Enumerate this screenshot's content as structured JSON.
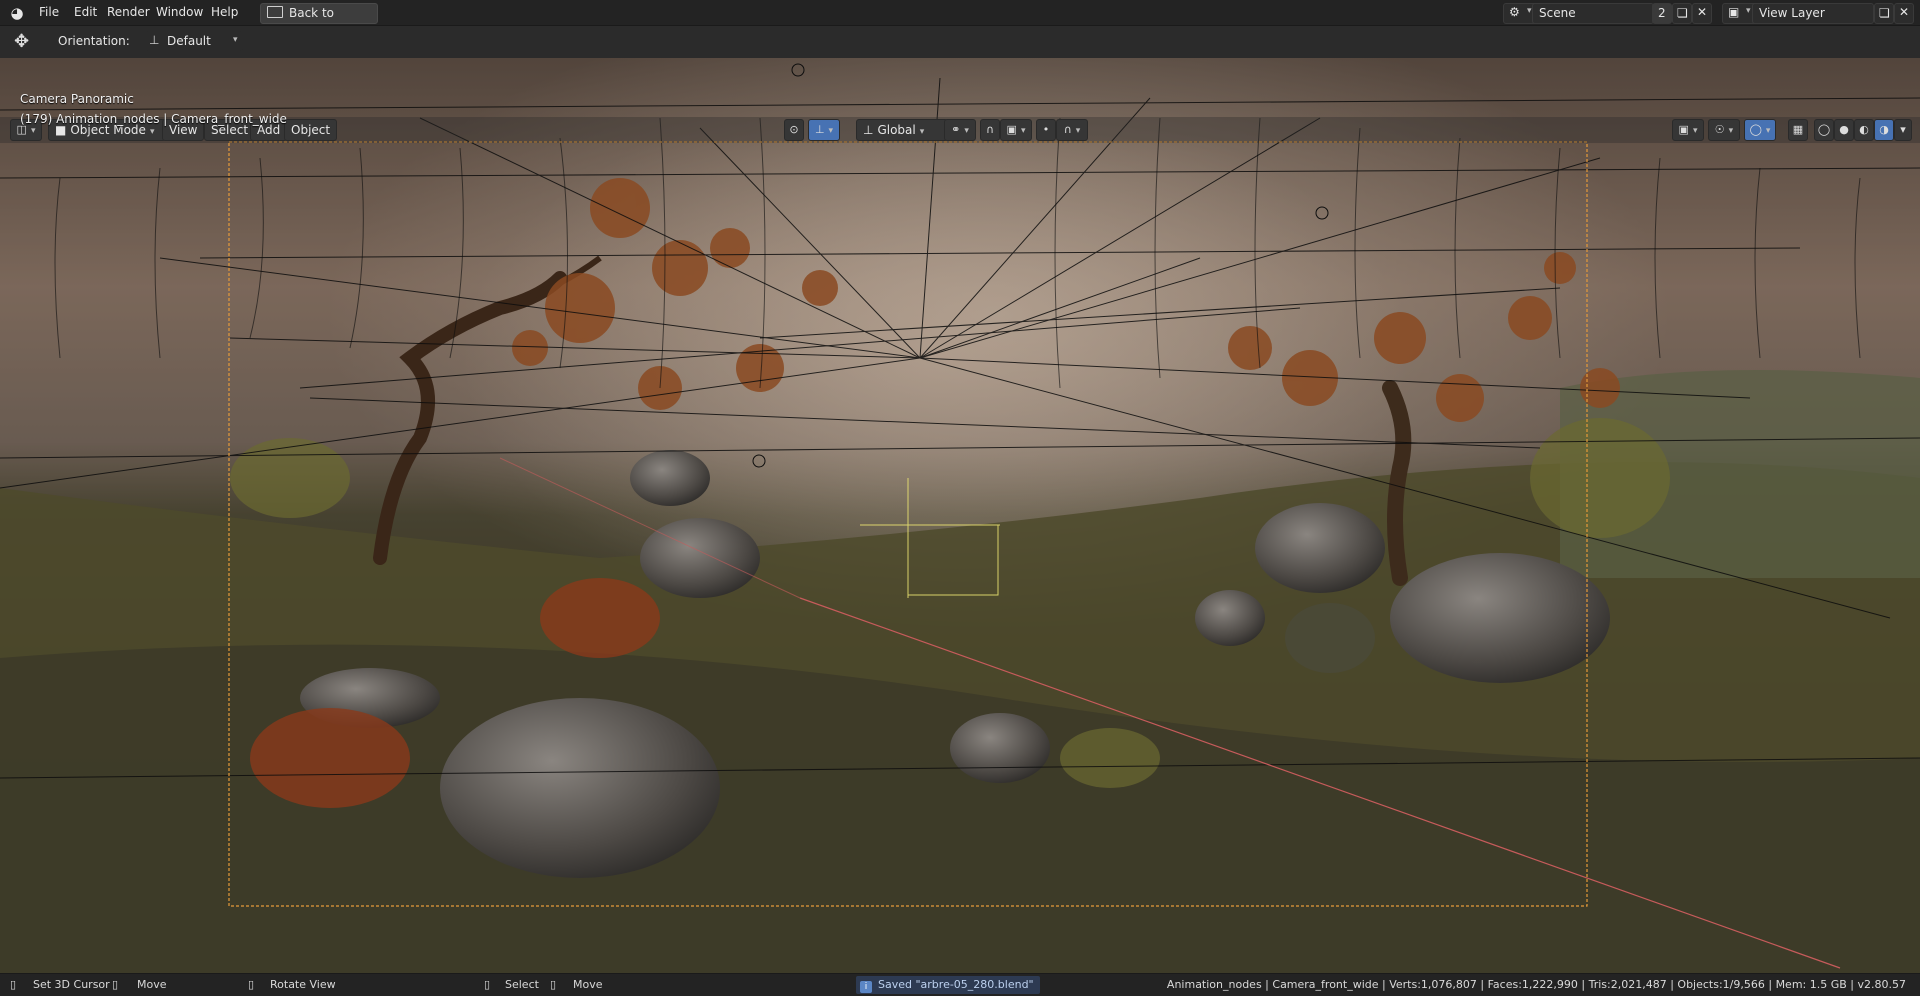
{
  "topbar": {
    "menus": [
      "File",
      "Edit",
      "Render",
      "Window",
      "Help"
    ],
    "back_label": "Back to Previous",
    "scene_name": "Scene",
    "scene_users": "2",
    "view_layer": "View Layer"
  },
  "tool_header": {
    "orientation_label": "Orientation:",
    "orientation_value": "Default"
  },
  "viewport_header": {
    "mode": "Object Mode",
    "menus": [
      "View",
      "Select",
      "Add",
      "Object"
    ],
    "transform_orientation": "Global"
  },
  "viewport": {
    "camera_label": "Camera Panoramic",
    "object_info": "(179) Animation_nodes | Camera_front_wide"
  },
  "statusbar": {
    "set_cursor": "Set 3D Cursor",
    "move1": "Move",
    "rotate": "Rotate View",
    "select": "Select",
    "move2": "Move",
    "saved_msg": "Saved \"arbre-05_280.blend\"",
    "stats": "Animation_nodes | Camera_front_wide | Verts:1,076,807 | Faces:1,222,990 | Tris:2,021,487 | Objects:1/9,566 | Mem: 1.5 GB | v2.80.57"
  },
  "colors": {
    "accent": "#4772b3",
    "camera_frame": "#e59a3a",
    "x_axis": "#c65b5b"
  }
}
